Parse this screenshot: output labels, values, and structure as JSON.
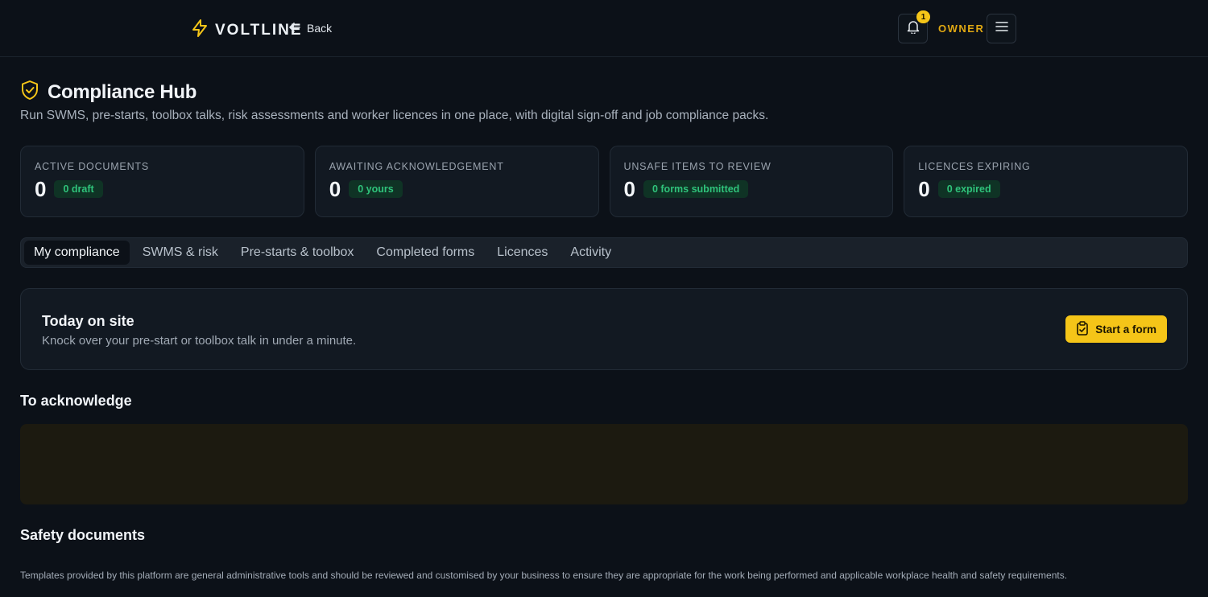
{
  "header": {
    "brand_name": "VOLTLINE",
    "back_label": "Back",
    "notification_count": "1",
    "role_label": "OWNER"
  },
  "page": {
    "title": "Compliance Hub",
    "subtitle": "Run SWMS, pre-starts, toolbox talks, risk assessments and worker licences in one place, with digital sign-off and job compliance packs."
  },
  "stats": [
    {
      "label": "ACTIVE DOCUMENTS",
      "value": "0",
      "pill": "0 draft"
    },
    {
      "label": "AWAITING ACKNOWLEDGEMENT",
      "value": "0",
      "pill": "0 yours"
    },
    {
      "label": "UNSAFE ITEMS TO REVIEW",
      "value": "0",
      "pill": "0 forms submitted"
    },
    {
      "label": "LICENCES EXPIRING",
      "value": "0",
      "pill": "0 expired"
    }
  ],
  "tabs": [
    {
      "label": "My compliance",
      "active": true
    },
    {
      "label": "SWMS & risk"
    },
    {
      "label": "Pre-starts & toolbox"
    },
    {
      "label": "Completed forms"
    },
    {
      "label": "Licences"
    },
    {
      "label": "Activity"
    }
  ],
  "today": {
    "title": "Today on site",
    "subtitle": "Knock over your pre-start or toolbox talk in under a minute.",
    "button_label": "Start a form"
  },
  "sections": {
    "acknowledge_title": "To acknowledge",
    "safety_title": "Safety documents"
  },
  "footer": {
    "disclaimer": "Templates provided by this platform are general administrative tools and should be reviewed and customised by your business to ensure they are appropriate for the work being performed and applicable workplace health and safety requirements."
  },
  "colors": {
    "accent": "#f5c518",
    "background": "#0c1118",
    "success": "#2fc37b"
  },
  "icons": {
    "brand": "lightning-bolt-icon",
    "back": "arrow-left-icon",
    "bell": "bell-icon",
    "menu": "hamburger-menu-icon",
    "title": "shield-check-icon",
    "start": "clipboard-check-icon"
  }
}
